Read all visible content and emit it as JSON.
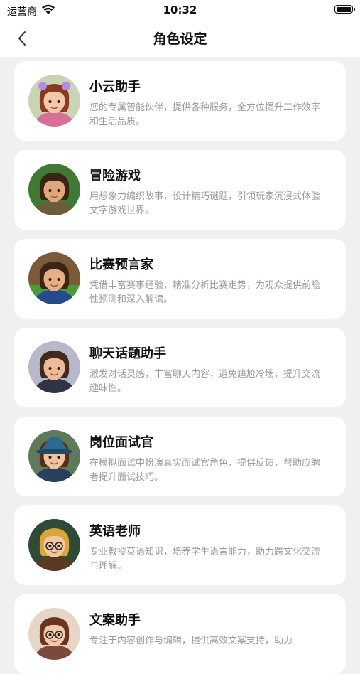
{
  "status_bar": {
    "carrier": "运营商",
    "time": "10:32"
  },
  "header": {
    "title": "角色设定"
  },
  "roles": [
    {
      "title": "小云助手",
      "description": "您的专属智能伙伴，提供各种服务，全方位提升工作效率和生活品质。",
      "avatar": "girl-avatar",
      "colors": {
        "bg": "#c9d4b6",
        "hair": "#8a3b1f",
        "skin": "#f4c7a8",
        "cloth": "#d96e96",
        "accent": "#b68ce0"
      }
    },
    {
      "title": "冒险游戏",
      "description": "用想象力编织故事，设计精巧谜题，引领玩家沉浸式体验文字游戏世界。",
      "avatar": "adventurer-avatar",
      "colors": {
        "bg": "#3f7a35",
        "hair": "#3a2414",
        "skin": "#e0a77d",
        "cloth": "#6b5d3a",
        "accent": "#2d5c26"
      }
    },
    {
      "title": "比赛预言家",
      "description": "凭借丰富赛事经验，精准分析比赛走势，为观众提供前瞻性预测和深入解读。",
      "avatar": "stadium-boy-avatar",
      "colors": {
        "bg": "#7a5a38",
        "hair": "#3b2616",
        "skin": "#e6b086",
        "cloth": "#284a8a",
        "accent": "#4c9a3a"
      }
    },
    {
      "title": "聊天话题助手",
      "description": "激发对话灵感，丰富聊天内容，避免尴尬冷场，提升交流趣味性。",
      "avatar": "chat-boy-avatar",
      "colors": {
        "bg": "#b7b9cb",
        "hair": "#3f2a1d",
        "skin": "#edbb95",
        "cloth": "#2f3445",
        "accent": "#8f93a8"
      }
    },
    {
      "title": "岗位面试官",
      "description": "在模拟面试中扮演真实面试官角色，提供反馈，帮助应聘者提升面试技巧。",
      "avatar": "interviewer-avatar",
      "colors": {
        "bg": "#5f7a5a",
        "hair": "#5a2c1a",
        "skin": "#f0c3a0",
        "cloth": "#2a3f5a",
        "accent": "#2c6a8f"
      }
    },
    {
      "title": "英语老师",
      "description": "专业教授英语知识，培养学生语言能力，助力跨文化交流与理解。",
      "avatar": "teacher-avatar",
      "colors": {
        "bg": "#2f4a36",
        "hair": "#d9a63a",
        "skin": "#f0c7a2",
        "cloth": "#5a3a22",
        "accent": "#c98a2a"
      }
    },
    {
      "title": "文案助手",
      "description": "专注于内容创作与编辑，提供高效文案支持，助力",
      "avatar": "writer-avatar",
      "colors": {
        "bg": "#e7d5c6",
        "hair": "#6a3520",
        "skin": "#f2c9ab",
        "cloth": "#7a4a3a",
        "accent": "#b07055"
      }
    }
  ]
}
